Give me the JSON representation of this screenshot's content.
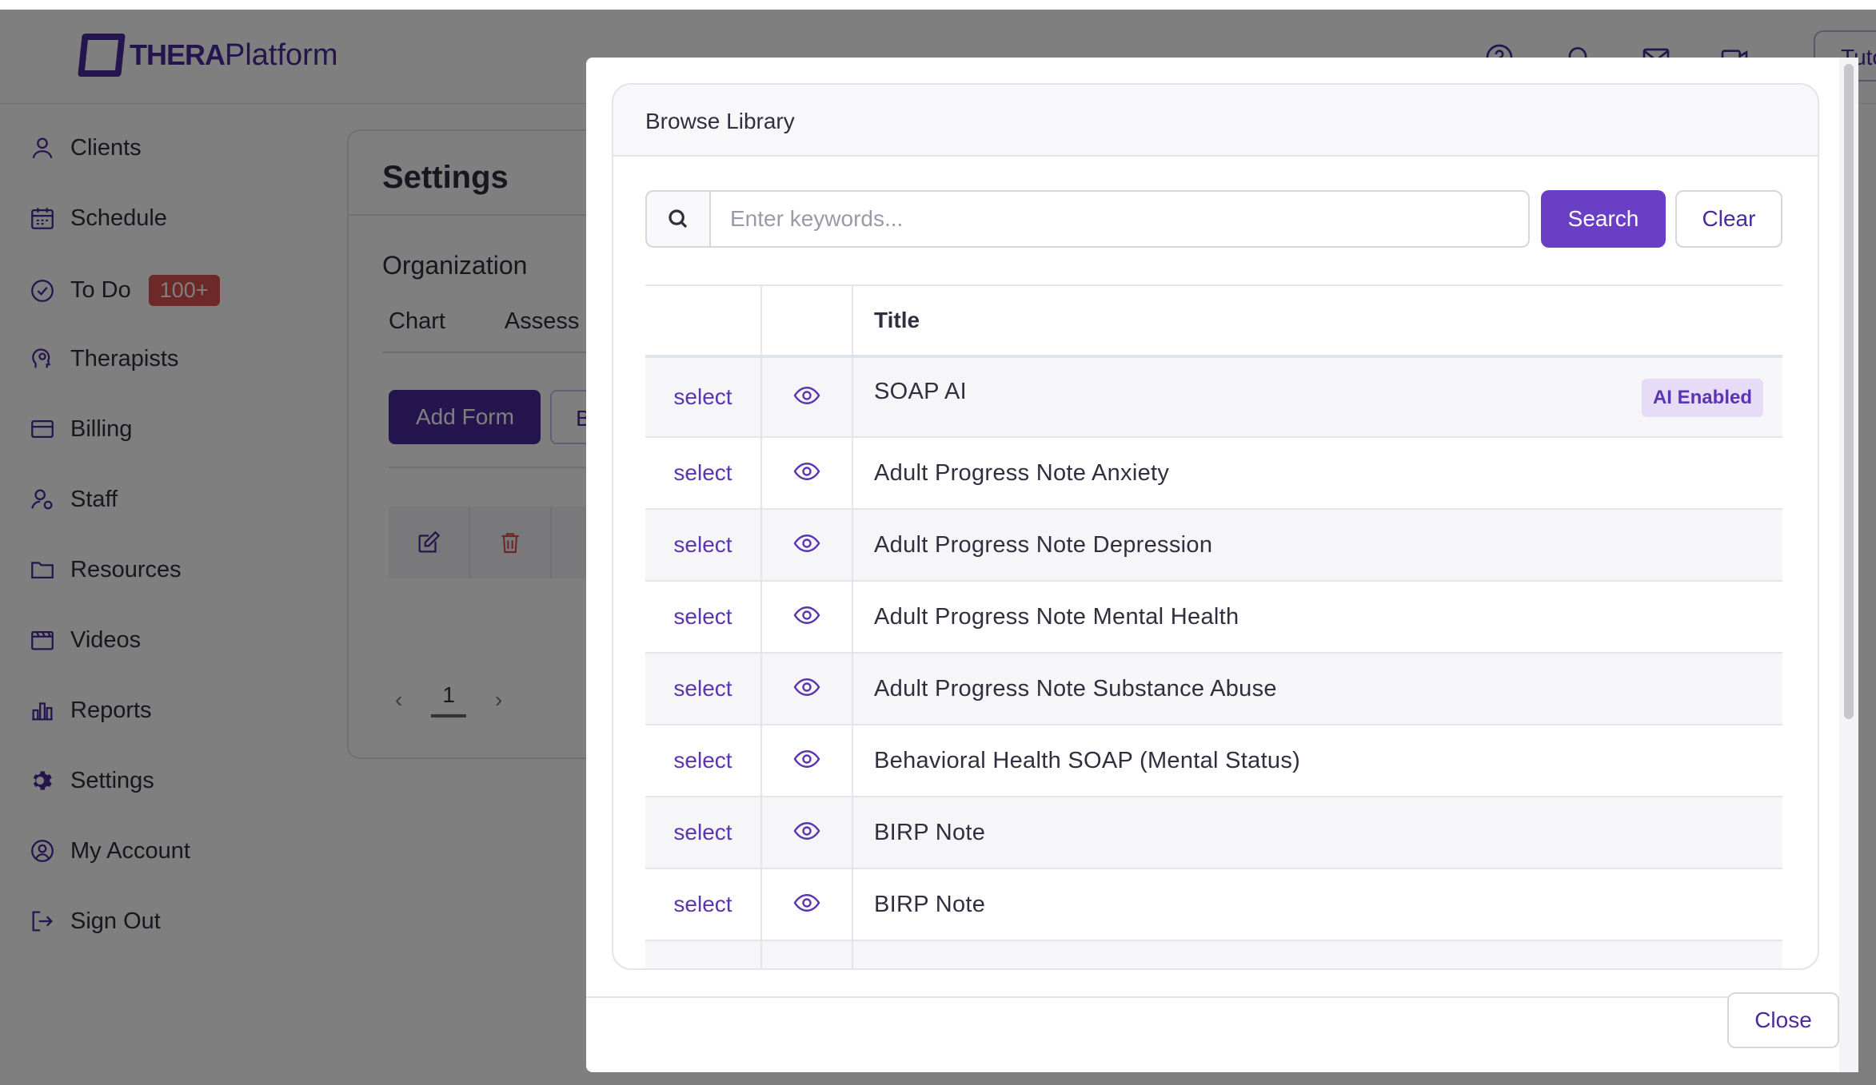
{
  "app": {
    "logo_bold": "THERA",
    "logo_rest": "Platform",
    "tutorial_label": "Tuto"
  },
  "sidebar": {
    "items": [
      {
        "label": "Clients",
        "icon": "user-icon"
      },
      {
        "label": "Schedule",
        "icon": "calendar-icon"
      },
      {
        "label": "To Do",
        "icon": "check-circle-icon",
        "badge": "100+"
      },
      {
        "label": "Therapists",
        "icon": "head-icon"
      },
      {
        "label": "Billing",
        "icon": "card-icon"
      },
      {
        "label": "Staff",
        "icon": "staff-icon"
      },
      {
        "label": "Resources",
        "icon": "folder-icon"
      },
      {
        "label": "Videos",
        "icon": "film-icon"
      },
      {
        "label": "Reports",
        "icon": "bar-chart-icon"
      },
      {
        "label": "Settings",
        "icon": "gear-icon"
      },
      {
        "label": "My Account",
        "icon": "account-icon"
      },
      {
        "label": "Sign Out",
        "icon": "sign-out-icon"
      }
    ]
  },
  "settings": {
    "title": "Settings",
    "section": "Organization",
    "tabs": [
      "Chart",
      "Assess"
    ],
    "add_form_label": "Add Form",
    "b_label": "B",
    "page": "1"
  },
  "modal": {
    "title": "Browse Library",
    "search": {
      "placeholder": "Enter keywords...",
      "value": ""
    },
    "search_button": "Search",
    "clear_button": "Clear",
    "table": {
      "header_title": "Title",
      "select_label": "select",
      "rows": [
        {
          "title": "SOAP AI",
          "badge": "AI Enabled"
        },
        {
          "title": "Adult Progress Note Anxiety"
        },
        {
          "title": "Adult Progress Note Depression"
        },
        {
          "title": "Adult Progress Note Mental Health"
        },
        {
          "title": "Adult Progress Note Substance Abuse"
        },
        {
          "title": "Behavioral Health SOAP (Mental Status)"
        },
        {
          "title": "BIRP Note"
        },
        {
          "title": "BIRP Note"
        }
      ]
    },
    "close_button": "Close"
  },
  "colors": {
    "brand": "#4b2a9c",
    "primary_button": "#6a3fc5",
    "badge_red": "#d9534f",
    "ai_badge_bg": "#e6dcf7"
  }
}
